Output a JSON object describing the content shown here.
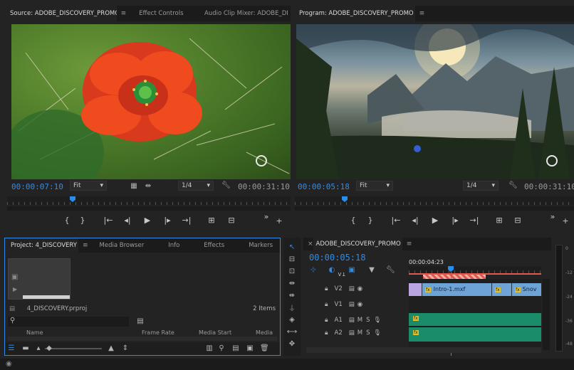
{
  "source": {
    "tabs": [
      "Source: ADOBE_DISCOVERY_PROMO",
      "Effect Controls",
      "Audio Clip Mixer: ADOBE_DI"
    ],
    "timecode_in": "00:00:07:10",
    "fit": "Fit",
    "resolution": "1/4",
    "timecode_dur": "00:00:31:10"
  },
  "program": {
    "tab": "Program: ADOBE_DISCOVERY_PROMO",
    "timecode_in": "00:00:05:18",
    "fit": "Fit",
    "resolution": "1/4",
    "timecode_dur": "00:00:31:10"
  },
  "project": {
    "tabs": [
      "Project: 4_DISCOVERY",
      "Media Browser",
      "Info",
      "Effects",
      "Markers"
    ],
    "file": "4_DISCOVERY.prproj",
    "items": "2 Items",
    "columns": [
      "Name",
      "Frame Rate",
      "Media Start",
      "Media E"
    ]
  },
  "timeline": {
    "tab": "ADOBE_DISCOVERY_PROMO",
    "timecode": "00:00:05:18",
    "ruler_time": "00:00:04:23",
    "tracks": [
      {
        "name": "V1",
        "kind": "video",
        "partial": true
      },
      {
        "name": "V2",
        "kind": "video"
      },
      {
        "name": "V1",
        "kind": "video"
      },
      {
        "name": "A1",
        "kind": "audio"
      },
      {
        "name": "A2",
        "kind": "audio"
      }
    ],
    "clips": [
      "Intro-1.mxf",
      "Snov"
    ],
    "fx": "fx"
  },
  "meter": {
    "labels": [
      "0",
      "-12",
      "-24",
      "-36",
      "-48"
    ]
  },
  "colors": {
    "accent": "#2d8ceb",
    "audio_clip": "#1a8c6a",
    "video_clip": "#6ea3d8",
    "in_out": "#e3584c"
  }
}
